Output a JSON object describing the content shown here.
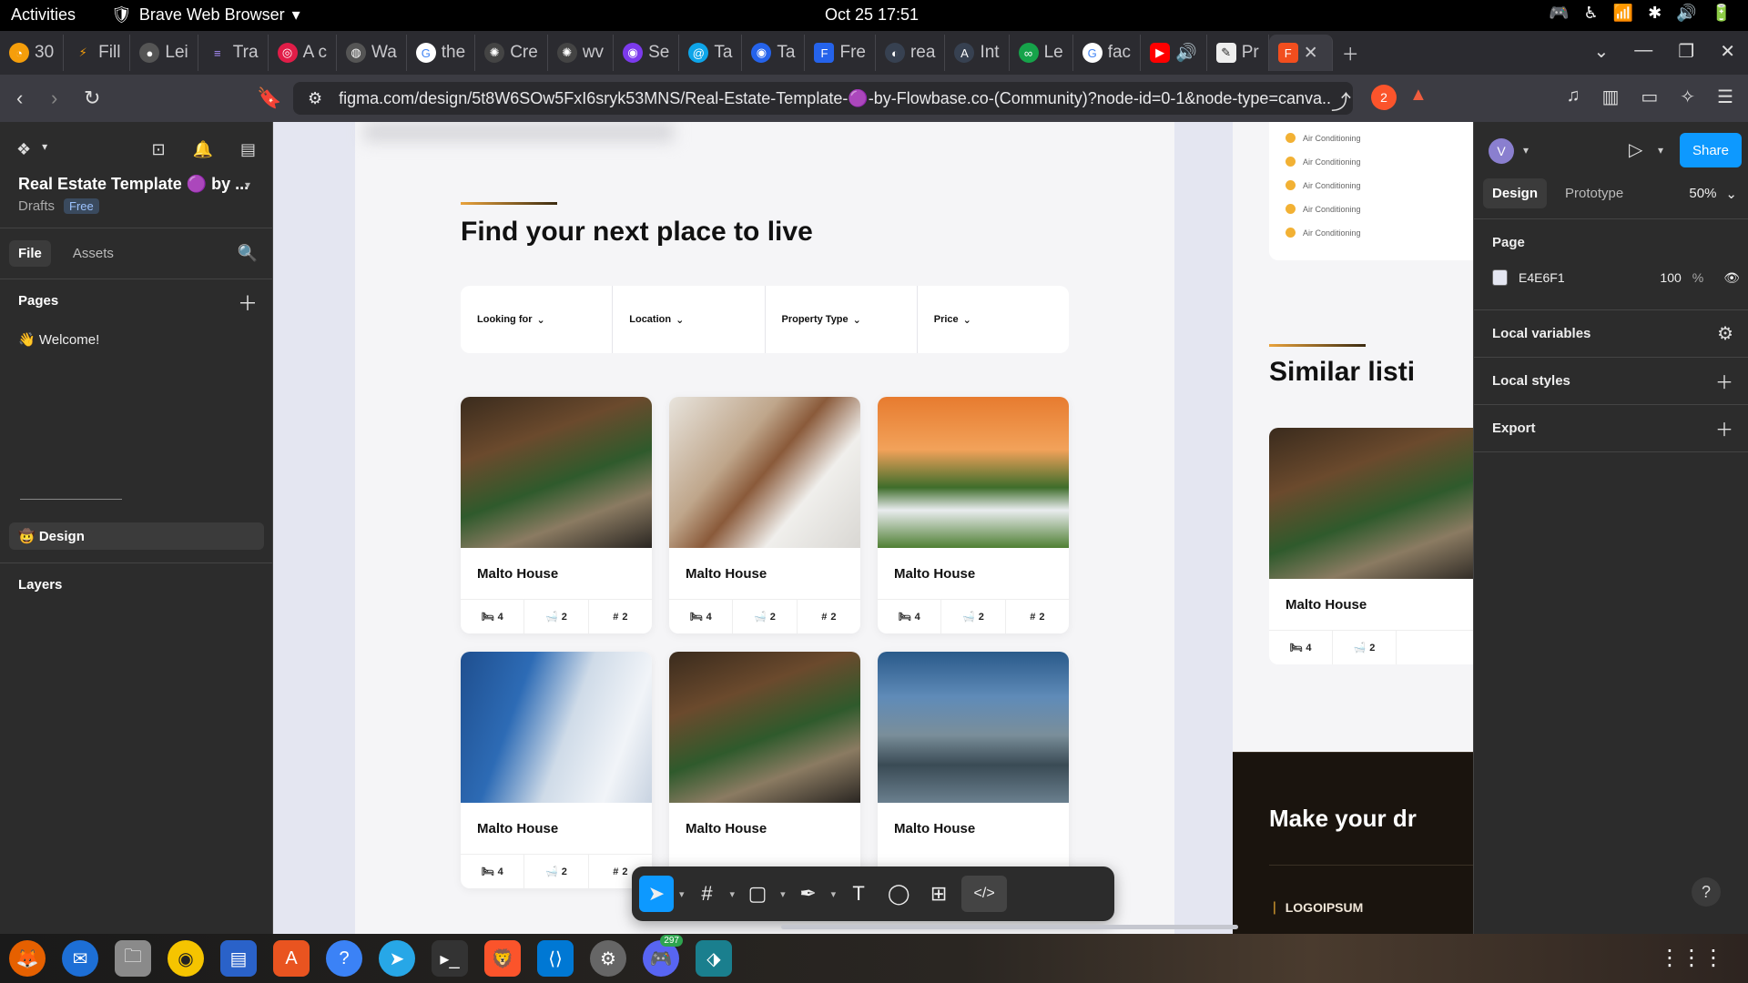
{
  "system": {
    "activities": "Activities",
    "app_name": "Brave Web Browser",
    "clock": "Oct 25  17:51"
  },
  "tabs": [
    {
      "label": "30",
      "icon": "pie-icon",
      "color": "#f59e0b"
    },
    {
      "label": "Fill",
      "icon": "lightning-icon",
      "color": "#f59e0b"
    },
    {
      "label": "Lei",
      "icon": "github-icon",
      "color": "#333333"
    },
    {
      "label": "Tra",
      "icon": "stack-icon",
      "color": "#6f42c1"
    },
    {
      "label": "A c",
      "icon": "circle-icon",
      "color": "#e11d48"
    },
    {
      "label": "Wa",
      "icon": "globe-icon",
      "color": "#555555"
    },
    {
      "label": "the",
      "icon": "google-icon",
      "color": "#ffffff"
    },
    {
      "label": "Cre",
      "icon": "openai-icon",
      "color": "#444444"
    },
    {
      "label": "wv",
      "icon": "openai-icon",
      "color": "#444444"
    },
    {
      "label": "Se",
      "icon": "circle-icon",
      "color": "#7c3aed"
    },
    {
      "label": "Ta",
      "icon": "spiral-icon",
      "color": "#0ea5e9"
    },
    {
      "label": "Ta",
      "icon": "circle-icon",
      "color": "#2563eb"
    },
    {
      "label": "Fre",
      "icon": "form-icon",
      "color": "#2563eb"
    },
    {
      "label": "rea",
      "icon": "circle-icon",
      "color": "#374151"
    },
    {
      "label": "Int",
      "icon": "circle-icon",
      "color": "#374151"
    },
    {
      "label": "Le",
      "icon": "circle-icon",
      "color": "#16a34a"
    },
    {
      "label": "fac",
      "icon": "google-icon",
      "color": "#ffffff"
    },
    {
      "label": "",
      "icon": "youtube-icon",
      "color": "#ff0000"
    },
    {
      "label": "Pr",
      "icon": "doc-icon",
      "color": "#374151"
    },
    {
      "label": "",
      "icon": "figma-icon",
      "color": "#f24e1e"
    }
  ],
  "address": {
    "url": "figma.com/design/5t8W6SOw5FxI6sryk53MNS/Real-Estate-Template-🟣-by-Flowbase.co-(Community)?node-id=0-1&node-type=canva...",
    "brave_count": "2",
    "alert_count": "1"
  },
  "figma_left": {
    "file_title": "Real Estate Template 🟣 by ...",
    "drafts": "Drafts",
    "plan_badge": "Free",
    "tab_file": "File",
    "tab_assets": "Assets",
    "pages_heading": "Pages",
    "page_welcome": "👋 Welcome!",
    "page_design": "🤠 Design",
    "layers_heading": "Layers"
  },
  "canvas": {
    "headline": "Find your next place to live",
    "filters": [
      {
        "label": "Looking for"
      },
      {
        "label": "Location"
      },
      {
        "label": "Property Type"
      },
      {
        "label": "Price"
      }
    ],
    "cards": [
      {
        "title": "Malto House",
        "beds": "4",
        "baths": "2",
        "area": "2",
        "image": "interior"
      },
      {
        "title": "Malto House",
        "beds": "4",
        "baths": "2",
        "area": "2",
        "image": "living"
      },
      {
        "title": "Malto House",
        "beds": "4",
        "baths": "2",
        "area": "2",
        "image": "sunset"
      },
      {
        "title": "Malto House",
        "beds": "4",
        "baths": "2",
        "area": "2",
        "image": "bedroom"
      },
      {
        "title": "Malto House",
        "beds": "",
        "baths": "",
        "area": "",
        "image": "interior"
      },
      {
        "title": "Malto House",
        "beds": "",
        "baths": "",
        "area": "",
        "image": "dusk"
      }
    ],
    "amenities": [
      "Air Conditioning",
      "Air Conditioning",
      "Air Conditioning",
      "Air Conditioning",
      "Air Conditioning"
    ],
    "similar_heading": "Similar listi",
    "similar_card": {
      "title": "Malto House",
      "beds": "4",
      "baths": "2"
    },
    "dream_heading": "Make your dr",
    "logo_text": "LOGOIPSUM"
  },
  "figma_right": {
    "avatar": "V",
    "share": "Share",
    "tab_design": "Design",
    "tab_prototype": "Prototype",
    "zoom": "50%",
    "page_heading": "Page",
    "page_color": "E4E6F1",
    "page_opacity": "100",
    "percent": "%",
    "local_variables": "Local variables",
    "local_styles": "Local styles",
    "export": "Export",
    "help": "?"
  },
  "dock": {
    "discord_badge": "297"
  },
  "colors": {
    "figma_blue": "#0d99ff",
    "canvas_bg": "#e4e6f1",
    "accent_gold": "#f2b134"
  }
}
